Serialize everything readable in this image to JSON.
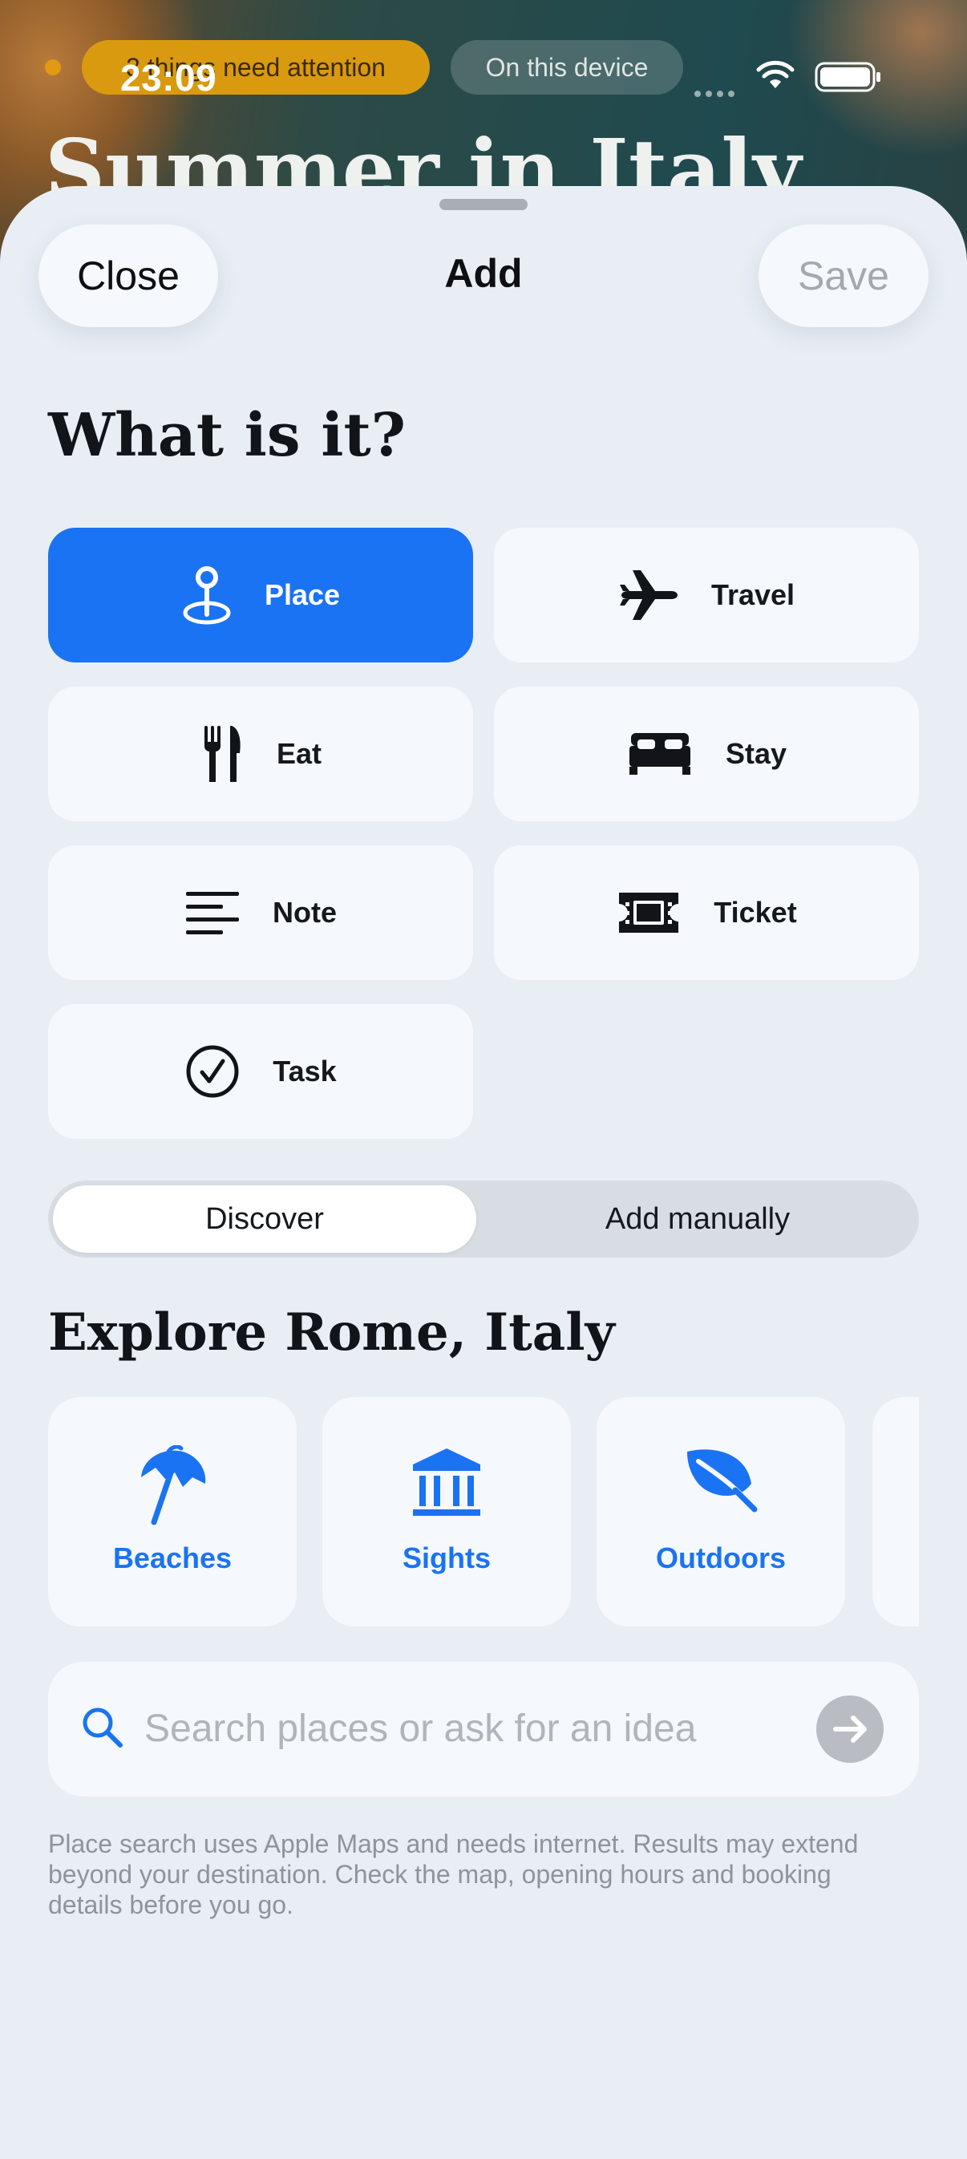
{
  "status_bar": {
    "time": "23:09",
    "attention": "3 things need attention",
    "device": "On this device"
  },
  "background": {
    "trip_title": "Summer in Italy"
  },
  "sheet": {
    "close_label": "Close",
    "title": "Add",
    "save_label": "Save",
    "question": "What is it?",
    "types": [
      {
        "label": "Place",
        "icon": "map-pin-icon",
        "selected": true
      },
      {
        "label": "Travel",
        "icon": "airplane-icon",
        "selected": false
      },
      {
        "label": "Eat",
        "icon": "fork-knife-icon",
        "selected": false
      },
      {
        "label": "Stay",
        "icon": "bed-icon",
        "selected": false
      },
      {
        "label": "Note",
        "icon": "note-lines-icon",
        "selected": false
      },
      {
        "label": "Ticket",
        "icon": "ticket-icon",
        "selected": false
      },
      {
        "label": "Task",
        "icon": "checkmark-circle-icon",
        "selected": false
      }
    ],
    "segment": {
      "discover": "Discover",
      "manual": "Add manually",
      "selected": "Discover"
    },
    "explore_heading": "Explore Rome, Italy",
    "categories": [
      {
        "label": "Beaches",
        "icon": "beach-umbrella-icon"
      },
      {
        "label": "Sights",
        "icon": "landmark-icon"
      },
      {
        "label": "Outdoors",
        "icon": "leaf-icon"
      }
    ],
    "search_placeholder": "Search places or ask for an idea",
    "disclaimer": "Place search uses Apple Maps and needs internet. Results may extend beyond your destination. Check the map, opening hours and booking details before you go."
  },
  "colors": {
    "accent": "#1a73f2",
    "sheet_bg": "#e9eef5",
    "card_bg": "#f5f8fc"
  }
}
